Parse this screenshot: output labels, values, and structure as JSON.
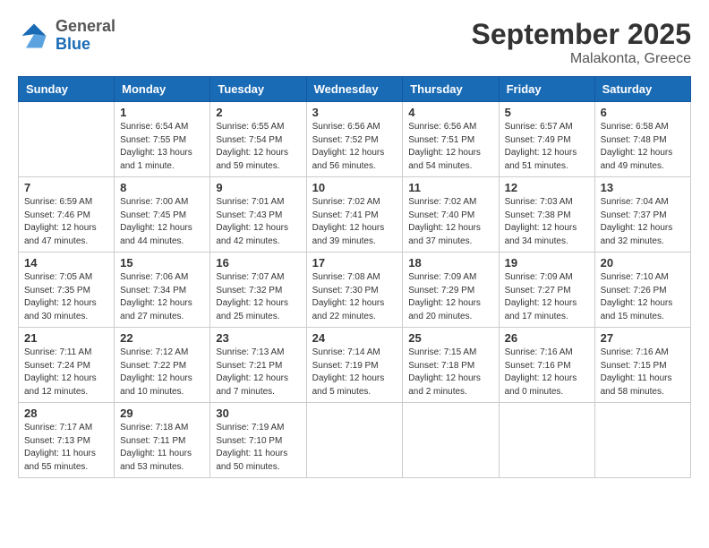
{
  "logo": {
    "line1": "General",
    "line2": "Blue"
  },
  "title": "September 2025",
  "location": "Malakonta, Greece",
  "days_of_week": [
    "Sunday",
    "Monday",
    "Tuesday",
    "Wednesday",
    "Thursday",
    "Friday",
    "Saturday"
  ],
  "weeks": [
    [
      {
        "day": "",
        "info": ""
      },
      {
        "day": "1",
        "info": "Sunrise: 6:54 AM\nSunset: 7:55 PM\nDaylight: 13 hours\nand 1 minute."
      },
      {
        "day": "2",
        "info": "Sunrise: 6:55 AM\nSunset: 7:54 PM\nDaylight: 12 hours\nand 59 minutes."
      },
      {
        "day": "3",
        "info": "Sunrise: 6:56 AM\nSunset: 7:52 PM\nDaylight: 12 hours\nand 56 minutes."
      },
      {
        "day": "4",
        "info": "Sunrise: 6:56 AM\nSunset: 7:51 PM\nDaylight: 12 hours\nand 54 minutes."
      },
      {
        "day": "5",
        "info": "Sunrise: 6:57 AM\nSunset: 7:49 PM\nDaylight: 12 hours\nand 51 minutes."
      },
      {
        "day": "6",
        "info": "Sunrise: 6:58 AM\nSunset: 7:48 PM\nDaylight: 12 hours\nand 49 minutes."
      }
    ],
    [
      {
        "day": "7",
        "info": "Sunrise: 6:59 AM\nSunset: 7:46 PM\nDaylight: 12 hours\nand 47 minutes."
      },
      {
        "day": "8",
        "info": "Sunrise: 7:00 AM\nSunset: 7:45 PM\nDaylight: 12 hours\nand 44 minutes."
      },
      {
        "day": "9",
        "info": "Sunrise: 7:01 AM\nSunset: 7:43 PM\nDaylight: 12 hours\nand 42 minutes."
      },
      {
        "day": "10",
        "info": "Sunrise: 7:02 AM\nSunset: 7:41 PM\nDaylight: 12 hours\nand 39 minutes."
      },
      {
        "day": "11",
        "info": "Sunrise: 7:02 AM\nSunset: 7:40 PM\nDaylight: 12 hours\nand 37 minutes."
      },
      {
        "day": "12",
        "info": "Sunrise: 7:03 AM\nSunset: 7:38 PM\nDaylight: 12 hours\nand 34 minutes."
      },
      {
        "day": "13",
        "info": "Sunrise: 7:04 AM\nSunset: 7:37 PM\nDaylight: 12 hours\nand 32 minutes."
      }
    ],
    [
      {
        "day": "14",
        "info": "Sunrise: 7:05 AM\nSunset: 7:35 PM\nDaylight: 12 hours\nand 30 minutes."
      },
      {
        "day": "15",
        "info": "Sunrise: 7:06 AM\nSunset: 7:34 PM\nDaylight: 12 hours\nand 27 minutes."
      },
      {
        "day": "16",
        "info": "Sunrise: 7:07 AM\nSunset: 7:32 PM\nDaylight: 12 hours\nand 25 minutes."
      },
      {
        "day": "17",
        "info": "Sunrise: 7:08 AM\nSunset: 7:30 PM\nDaylight: 12 hours\nand 22 minutes."
      },
      {
        "day": "18",
        "info": "Sunrise: 7:09 AM\nSunset: 7:29 PM\nDaylight: 12 hours\nand 20 minutes."
      },
      {
        "day": "19",
        "info": "Sunrise: 7:09 AM\nSunset: 7:27 PM\nDaylight: 12 hours\nand 17 minutes."
      },
      {
        "day": "20",
        "info": "Sunrise: 7:10 AM\nSunset: 7:26 PM\nDaylight: 12 hours\nand 15 minutes."
      }
    ],
    [
      {
        "day": "21",
        "info": "Sunrise: 7:11 AM\nSunset: 7:24 PM\nDaylight: 12 hours\nand 12 minutes."
      },
      {
        "day": "22",
        "info": "Sunrise: 7:12 AM\nSunset: 7:22 PM\nDaylight: 12 hours\nand 10 minutes."
      },
      {
        "day": "23",
        "info": "Sunrise: 7:13 AM\nSunset: 7:21 PM\nDaylight: 12 hours\nand 7 minutes."
      },
      {
        "day": "24",
        "info": "Sunrise: 7:14 AM\nSunset: 7:19 PM\nDaylight: 12 hours\nand 5 minutes."
      },
      {
        "day": "25",
        "info": "Sunrise: 7:15 AM\nSunset: 7:18 PM\nDaylight: 12 hours\nand 2 minutes."
      },
      {
        "day": "26",
        "info": "Sunrise: 7:16 AM\nSunset: 7:16 PM\nDaylight: 12 hours\nand 0 minutes."
      },
      {
        "day": "27",
        "info": "Sunrise: 7:16 AM\nSunset: 7:15 PM\nDaylight: 11 hours\nand 58 minutes."
      }
    ],
    [
      {
        "day": "28",
        "info": "Sunrise: 7:17 AM\nSunset: 7:13 PM\nDaylight: 11 hours\nand 55 minutes."
      },
      {
        "day": "29",
        "info": "Sunrise: 7:18 AM\nSunset: 7:11 PM\nDaylight: 11 hours\nand 53 minutes."
      },
      {
        "day": "30",
        "info": "Sunrise: 7:19 AM\nSunset: 7:10 PM\nDaylight: 11 hours\nand 50 minutes."
      },
      {
        "day": "",
        "info": ""
      },
      {
        "day": "",
        "info": ""
      },
      {
        "day": "",
        "info": ""
      },
      {
        "day": "",
        "info": ""
      }
    ]
  ]
}
